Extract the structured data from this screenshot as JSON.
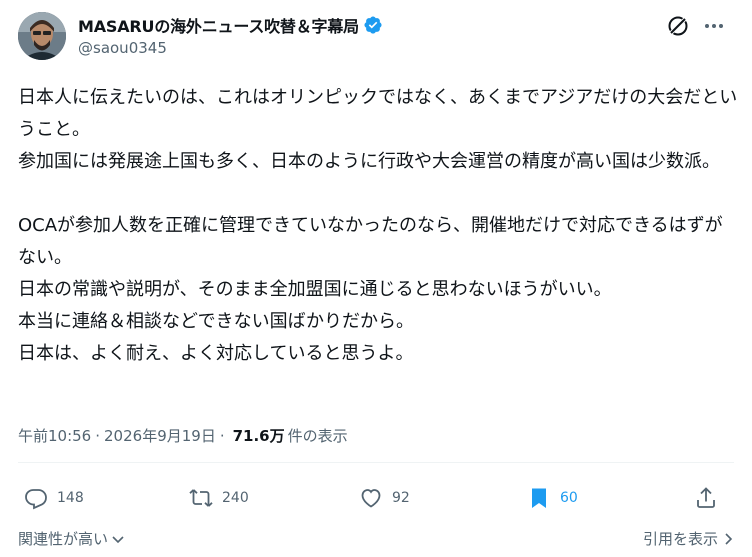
{
  "author": {
    "display_name": "MASARUの海外ニュース吹替＆字幕局",
    "handle": "@saou0345",
    "verified": true
  },
  "tweet": {
    "text": "日本人に伝えたいのは、これはオリンピックではなく、あくまでアジアだけの大会だということ。\n参加国には発展途上国も多く、日本のように行政や大会運営の精度が高い国は少数派。\n\nOCAが参加人数を正確に管理できていなかったのなら、開催地だけで対応できるはずがない。\n日本の常識や説明が、そのまま全加盟国に通じると思わないほうがいい。\n本当に連絡＆相談などできない国ばかりだから。\n日本は、よく耐え、よく対応していると思うよ。",
    "time": "午前10:56",
    "separator": "·",
    "date": "2026年9月19日",
    "views_count": "71.6万",
    "views_label": "件の表示"
  },
  "actions": {
    "reply_count": "148",
    "repost_count": "240",
    "like_count": "92",
    "bookmark_count": "60"
  },
  "footer": {
    "sort_label": "関連性が高い",
    "quote_label": "引用を表示"
  },
  "colors": {
    "accent": "#1d9bf0",
    "text": "#0f1419",
    "muted": "#536471"
  },
  "icons": [
    "verified-badge-icon",
    "grok-icon",
    "more-icon",
    "reply-icon",
    "repost-icon",
    "like-icon",
    "bookmark-icon",
    "share-icon",
    "chevron-down-icon"
  ]
}
